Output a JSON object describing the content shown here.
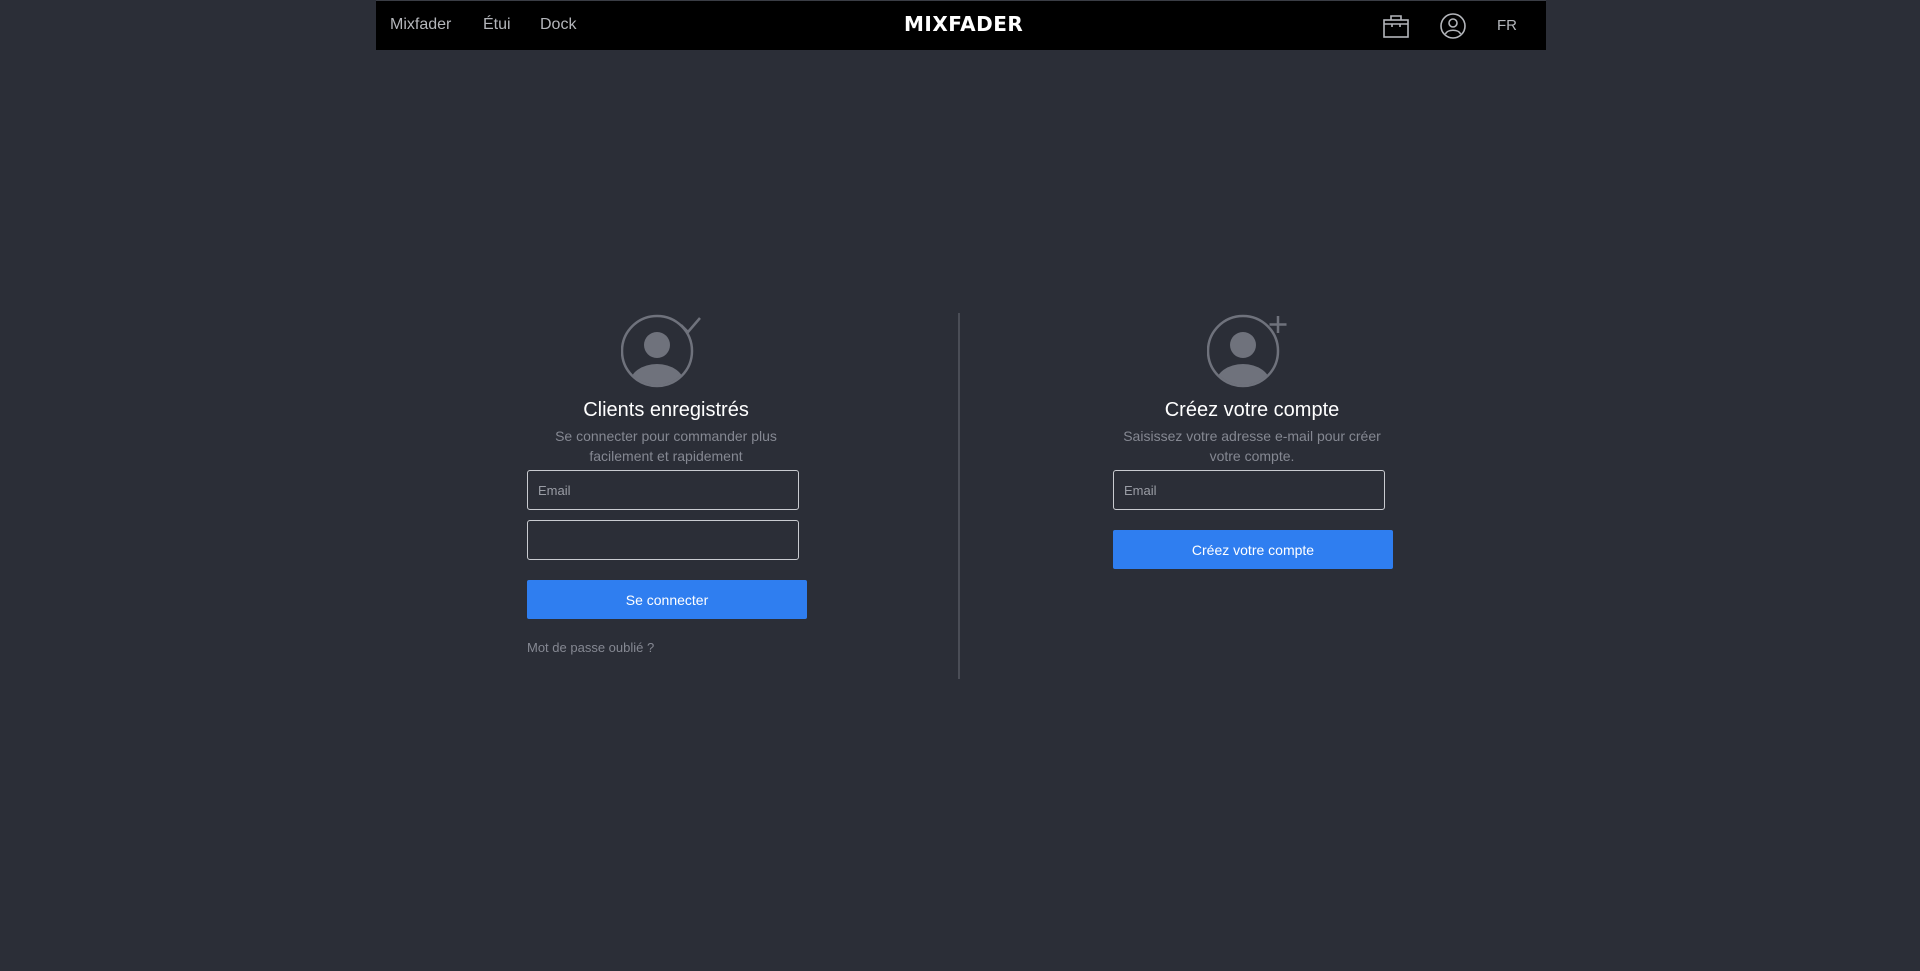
{
  "header": {
    "nav": [
      "Mixfader",
      "Étui",
      "Dock"
    ],
    "logo": "MIXFADER",
    "language": "FR",
    "icons": [
      "shopping-bag-icon",
      "user-account-icon"
    ]
  },
  "login": {
    "title": "Clients enregistrés",
    "subtitle": "Se connecter pour commander plus facilement et rapidement",
    "email_placeholder": "Email",
    "password_value": "",
    "submit_label": "Se connecter",
    "forgot_label": "Mot de passe oublié ?",
    "icon": "user-check-icon"
  },
  "register": {
    "title": "Créez votre compte",
    "subtitle": "Saisissez votre adresse e-mail pour créer votre compte.",
    "email_placeholder": "Email",
    "submit_label": "Créez votre compte",
    "icon": "user-add-icon"
  },
  "colors": {
    "background": "#2b2e37",
    "header": "#000000",
    "accent": "#2f7ef0",
    "muted_text": "#858892"
  }
}
